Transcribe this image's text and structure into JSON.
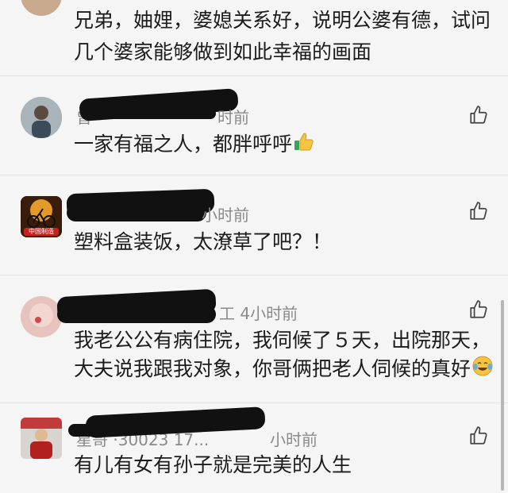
{
  "comments": [
    {
      "text_lines": [
        "兄弟，妯娌，婆媳关系好，说明公婆有德，试问",
        "几个婆家能够做到如此幸福的画面"
      ]
    },
    {
      "name_partial": "曾",
      "time": "时前",
      "text": "一家有福之人，都胖呼呼",
      "emoji": "thumbs-up-emoji"
    },
    {
      "avatar_text": "中国制造",
      "time": "小时前",
      "text": "塑料盒装饭，太潦草了吧？！"
    },
    {
      "time": "工 4小时前",
      "text_lines": [
        "我老公公有病住院，我伺候了５天，出院那天，",
        "大夫说我跟我对象，你哥俩把老人伺候的真好"
      ],
      "emoji": "crying-laughing-emoji"
    },
    {
      "name_partial": "星哥 ·30023 17...",
      "time": "小时前",
      "text": "有儿有女有孙子就是完美的人生"
    }
  ],
  "icons": {
    "like": "thumbs-up-outline-icon"
  }
}
